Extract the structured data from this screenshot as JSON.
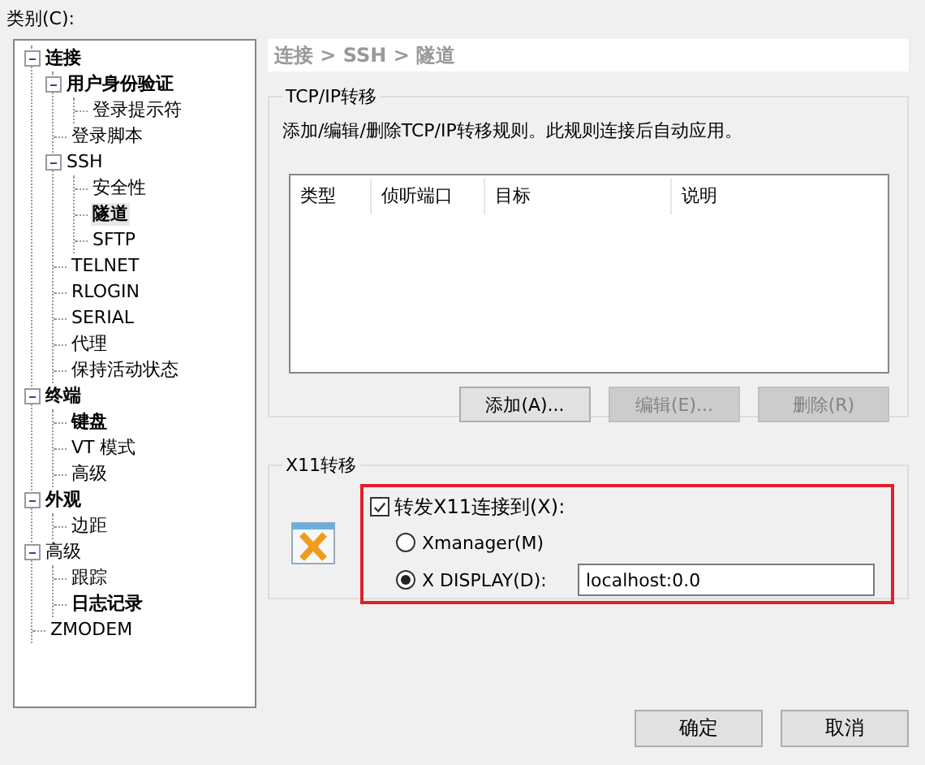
{
  "category_label": "类别(C):",
  "tree": [
    {
      "text": "连接",
      "bold": true,
      "selected": false,
      "expanded": true,
      "children": [
        {
          "text": "用户身份验证",
          "bold": true,
          "selected": false,
          "expanded": true,
          "children": [
            {
              "text": "登录提示符",
              "bold": false,
              "selected": false
            }
          ]
        },
        {
          "text": "登录脚本",
          "bold": false,
          "selected": false
        },
        {
          "text": "SSH",
          "bold": false,
          "selected": false,
          "expanded": true,
          "children": [
            {
              "text": "安全性",
              "bold": false,
              "selected": false
            },
            {
              "text": "隧道",
              "bold": true,
              "selected": true
            },
            {
              "text": "SFTP",
              "bold": false,
              "selected": false
            }
          ]
        },
        {
          "text": "TELNET",
          "bold": false,
          "selected": false
        },
        {
          "text": "RLOGIN",
          "bold": false,
          "selected": false
        },
        {
          "text": "SERIAL",
          "bold": false,
          "selected": false
        },
        {
          "text": "代理",
          "bold": false,
          "selected": false
        },
        {
          "text": "保持活动状态",
          "bold": false,
          "selected": false
        }
      ]
    },
    {
      "text": "终端",
      "bold": true,
      "selected": false,
      "expanded": true,
      "children": [
        {
          "text": "键盘",
          "bold": true,
          "selected": false
        },
        {
          "text": "VT 模式",
          "bold": false,
          "selected": false
        },
        {
          "text": "高级",
          "bold": false,
          "selected": false
        }
      ]
    },
    {
      "text": "外观",
      "bold": true,
      "selected": false,
      "expanded": true,
      "children": [
        {
          "text": "边距",
          "bold": false,
          "selected": false
        }
      ]
    },
    {
      "text": "高级",
      "bold": false,
      "selected": false,
      "expanded": true,
      "children": [
        {
          "text": "跟踪",
          "bold": false,
          "selected": false
        },
        {
          "text": "日志记录",
          "bold": true,
          "selected": false
        }
      ]
    },
    {
      "text": "ZMODEM",
      "bold": false,
      "selected": false
    }
  ],
  "breadcrumb": "连接 > SSH > 隧道",
  "tcp_group": {
    "title": "TCP/IP转移",
    "description": "添加/编辑/删除TCP/IP转移规则。此规则连接后自动应用。",
    "columns": [
      "类型",
      "侦听端口",
      "目标",
      "说明"
    ],
    "buttons": [
      {
        "label": "添加(A)...",
        "disabled": false
      },
      {
        "label": "编辑(E)...",
        "disabled": true
      },
      {
        "label": "删除(R)",
        "disabled": true
      }
    ]
  },
  "x11_group": {
    "title": "X11转移",
    "forward": {
      "label": "转发X11连接到(X):",
      "checked": true
    },
    "options": [
      {
        "label": "Xmanager(M)",
        "selected": false,
        "kind": "plain"
      },
      {
        "label": "X DISPLAY(D):",
        "selected": true,
        "kind": "field",
        "value": "localhost:0.0"
      }
    ]
  },
  "buttons": [
    "确定",
    "取消"
  ]
}
